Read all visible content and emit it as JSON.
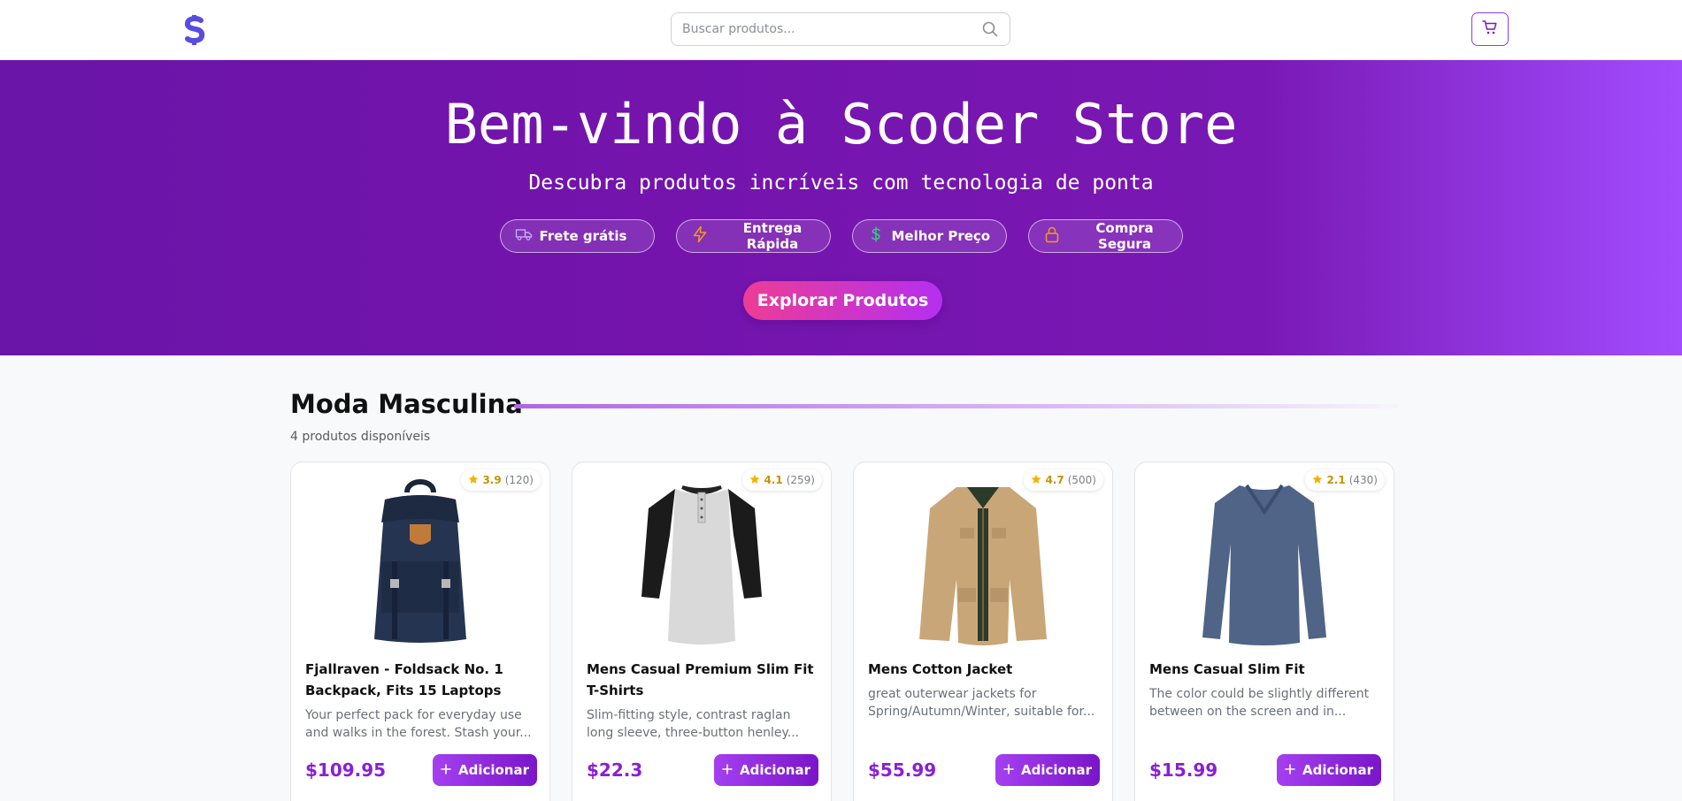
{
  "header": {
    "logo_icon": "dollar-s-logo",
    "search_placeholder": "Buscar produtos...",
    "search_icon": "search-icon",
    "cart_icon": "cart-icon"
  },
  "hero": {
    "title": "Bem-vindo à Scoder Store",
    "subtitle": "Descubra produtos incríveis com tecnologia de ponta",
    "features": [
      {
        "label": "Frete grátis",
        "icon": "truck-icon"
      },
      {
        "label": "Entrega Rápida",
        "icon": "lightning-icon"
      },
      {
        "label": "Melhor Preço",
        "icon": "dollar-icon"
      },
      {
        "label": "Compra Segura",
        "icon": "lock-icon"
      }
    ],
    "cta": "Explorar Produtos"
  },
  "section": {
    "title": "Moda Masculina",
    "count": "4 produtos disponíveis"
  },
  "products": [
    {
      "rating": "3.9",
      "reviews": "(120)",
      "title": "Fjallraven - Foldsack No. 1 Backpack, Fits 15 Laptops",
      "description": "Your perfect pack for everyday use and walks in the forest. Stash your...",
      "price": "$109.95",
      "add_label": "Adicionar"
    },
    {
      "rating": "4.1",
      "reviews": "(259)",
      "title": "Mens Casual Premium Slim Fit T-Shirts",
      "description": "Slim-fitting style, contrast raglan long sleeve, three-button henley...",
      "price": "$22.3",
      "add_label": "Adicionar"
    },
    {
      "rating": "4.7",
      "reviews": "(500)",
      "title": "Mens Cotton Jacket",
      "description": "great outerwear jackets for Spring/Autumn/Winter, suitable for...",
      "price": "$55.99",
      "add_label": "Adicionar"
    },
    {
      "rating": "2.1",
      "reviews": "(430)",
      "title": "Mens Casual Slim Fit",
      "description": "The color could be slightly different between on the screen and in...",
      "price": "$15.99",
      "add_label": "Adicionar"
    }
  ],
  "colors": {
    "accent": "#8a1fd6",
    "hero_start": "#6a14a8",
    "hero_end": "#a24cff",
    "cta_start": "#ec3d96",
    "star": "#f5b301"
  }
}
